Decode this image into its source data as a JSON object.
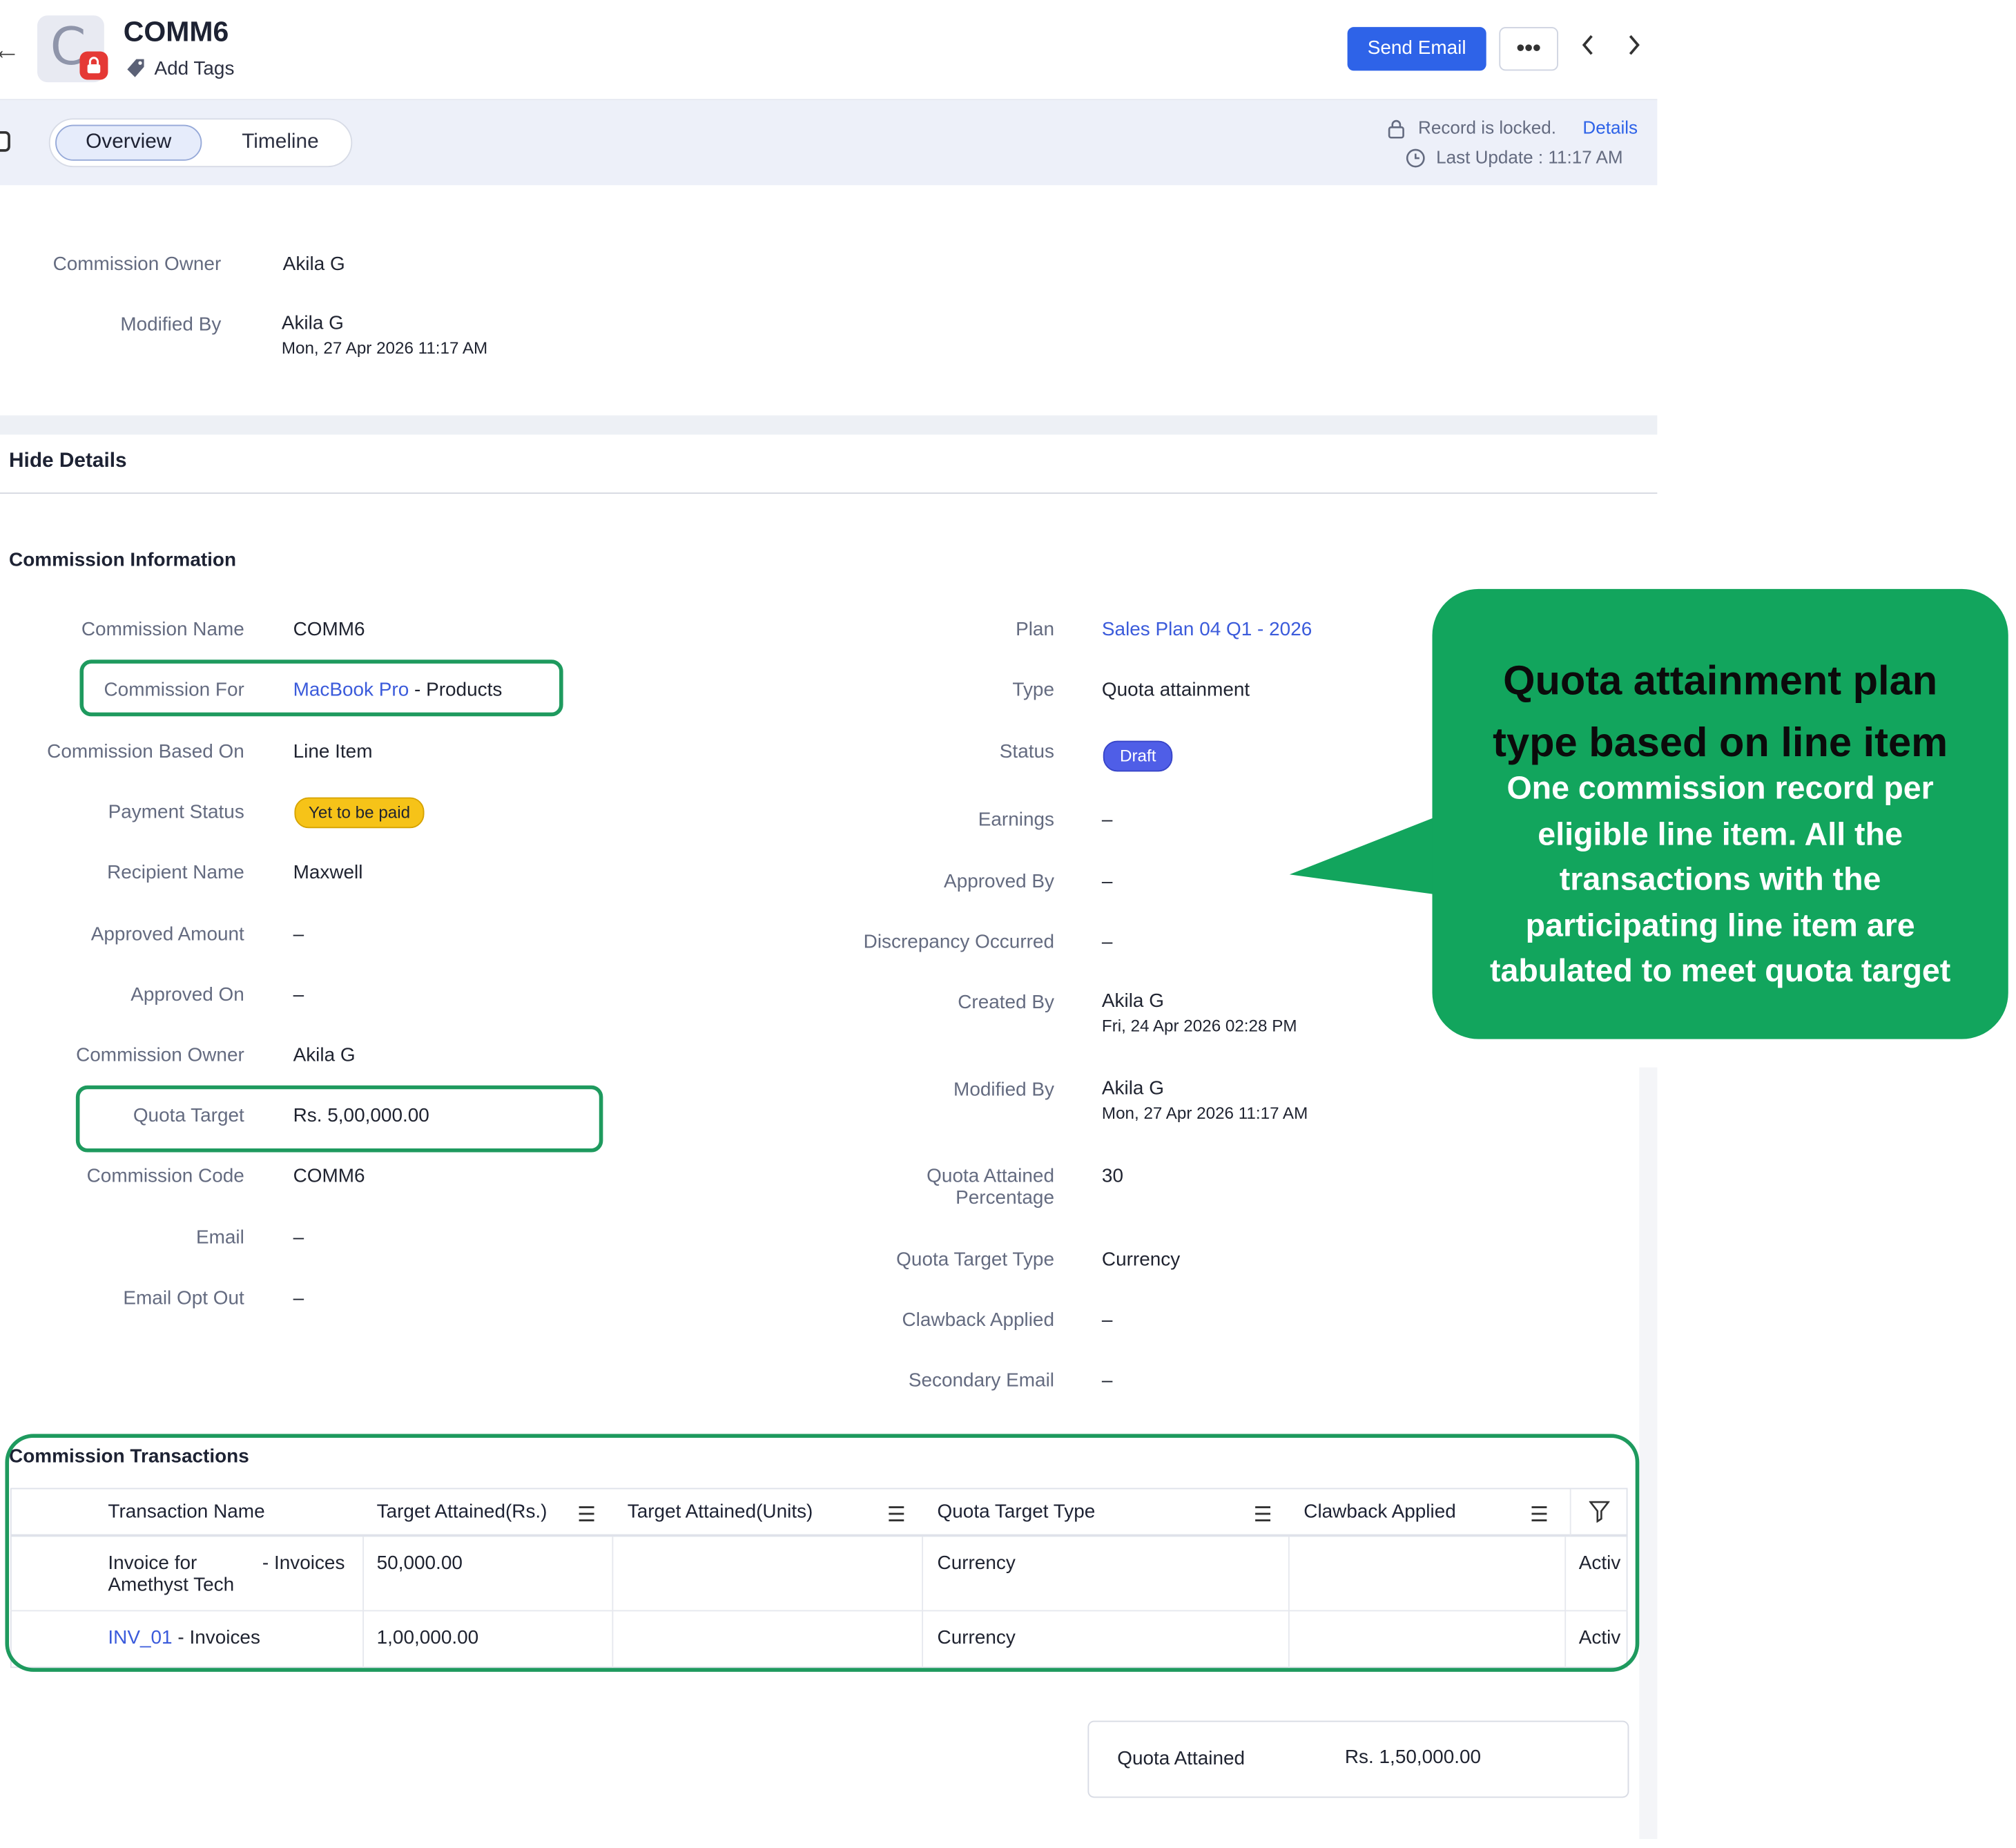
{
  "header": {
    "record_initial": "C",
    "title": "COMM6",
    "add_tags": "Add Tags",
    "send_email": "Send Email",
    "more": "•••",
    "prev": "‹",
    "next": "›"
  },
  "tabs": {
    "overview": "Overview",
    "timeline": "Timeline"
  },
  "status_bar": {
    "locked": "Record is locked.",
    "details": "Details",
    "last_update": "Last Update : 11:17 AM"
  },
  "summary": {
    "owner_label": "Commission Owner",
    "owner_value": "Akila G",
    "modified_label": "Modified By",
    "modified_value": "Akila G",
    "modified_date": "Mon, 27 Apr 2026 11:17 AM"
  },
  "details": {
    "hide_details": "Hide Details",
    "section_title": "Commission Information",
    "left": {
      "commission_name_label": "Commission Name",
      "commission_name": "COMM6",
      "commission_for_label": "Commission For",
      "commission_for_link": "MacBook Pro",
      "commission_for_suffix": " - Products",
      "based_on_label": "Commission Based On",
      "based_on": "Line Item",
      "payment_status_label": "Payment Status",
      "payment_status": "Yet to be paid",
      "recipient_label": "Recipient Name",
      "recipient": "Maxwell",
      "approved_amount_label": "Approved Amount",
      "approved_amount": "–",
      "approved_on_label": "Approved On",
      "approved_on": "–",
      "owner_label": "Commission Owner",
      "owner": "Akila G",
      "quota_target_label": "Quota Target",
      "quota_target": "Rs. 5,00,000.00",
      "code_label": "Commission Code",
      "code": "COMM6",
      "email_label": "Email",
      "email": "–",
      "email_opt_out_label": "Email Opt Out",
      "email_opt_out": "–"
    },
    "right": {
      "plan_label": "Plan",
      "plan": "Sales Plan 04 Q1 - 2026",
      "type_label": "Type",
      "type": "Quota attainment",
      "status_label": "Status",
      "status": "Draft",
      "earnings_label": "Earnings",
      "earnings": "–",
      "approved_by_label": "Approved By",
      "approved_by": "–",
      "discrepancy_label": "Discrepancy Occurred",
      "discrepancy": "–",
      "created_by_label": "Created By",
      "created_by": "Akila G",
      "created_date": "Fri, 24 Apr 2026 02:28 PM",
      "modified_by_label": "Modified By",
      "modified_by": "Akila G",
      "modified_date": "Mon, 27 Apr 2026 11:17 AM",
      "quota_pct_label_1": "Quota Attained",
      "quota_pct_label_2": "Percentage",
      "quota_pct": "30",
      "quota_type_label": "Quota Target Type",
      "quota_type": "Currency",
      "clawback_label": "Clawback Applied",
      "clawback": "–",
      "secondary_email_label": "Secondary Email",
      "secondary_email": "–"
    }
  },
  "callout": {
    "title_1": "Quota attainment plan",
    "title_2": "type based on line item",
    "body_1": "One commission record per",
    "body_2": "eligible line item. All the",
    "body_3": "transactions with the",
    "body_4": "participating line item are",
    "body_5": "tabulated to meet quota target"
  },
  "transactions": {
    "title": "Commission Transactions",
    "columns": [
      "Transaction Name",
      "Target Attained(Rs.)",
      "Target Attained(Units)",
      "Quota Target Type",
      "Clawback Applied"
    ],
    "rows": [
      {
        "name_link_1": "Invoice for",
        "name_link_2": "Amethyst Tech",
        "module": "- Invoices",
        "target_rs": "50,000.00",
        "target_units": "",
        "quota_type": "Currency",
        "clawback": "",
        "status": "Activ"
      },
      {
        "name_link_1": "INV_01",
        "module": " - Invoices",
        "target_rs": "1,00,000.00",
        "target_units": "",
        "quota_type": "Currency",
        "clawback": "",
        "status": "Activ"
      }
    ]
  },
  "quota_summary": {
    "label": "Quota Attained",
    "value": "Rs. 1,50,000.00"
  },
  "colors": {
    "primary": "#2e63e8",
    "link": "#3b5bdb",
    "highlight": "#1e9a5e",
    "callout": "#12a55d",
    "badge_yellow": "#f6c318",
    "badge_draft": "#4f5ee7"
  }
}
